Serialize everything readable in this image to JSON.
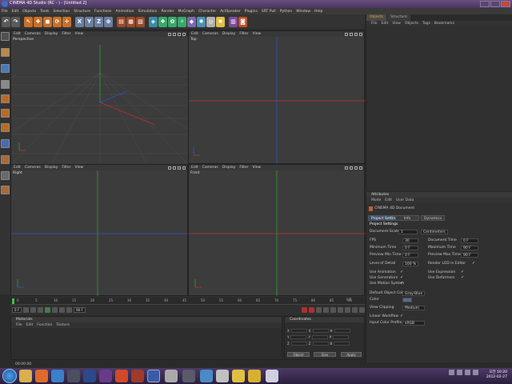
{
  "window": {
    "title": "CINEMA 4D Studio (RC - ) - [Untitled 2]"
  },
  "menubar": [
    "File",
    "Edit",
    "Objects",
    "Tools",
    "Selection",
    "Structure",
    "Functions",
    "Animation",
    "Simulation",
    "Render",
    "MoGraph",
    "Character",
    "ActSpeaker",
    "Plugins",
    "SRT Pull",
    "Python",
    "Window",
    "Help"
  ],
  "viewport_menu": [
    "Edit",
    "Cameras",
    "Display",
    "Filter",
    "View"
  ],
  "viewports": {
    "perspective": "Perspective",
    "top": "Top",
    "right": "Right",
    "front": "Front"
  },
  "timeline": {
    "ticks": [
      "0",
      "5",
      "10",
      "15",
      "20",
      "25",
      "30",
      "35",
      "40",
      "45",
      "50",
      "55",
      "60",
      "65",
      "70",
      "75",
      "80",
      "85",
      "90"
    ],
    "current_frame": "0 F",
    "start_field": "0 F",
    "end_field": "90 F",
    "end_label": "0 F"
  },
  "materials": {
    "title": "Materials",
    "menu": [
      "File",
      "Edit",
      "Function",
      "Texture"
    ]
  },
  "coordinates": {
    "title": "Coordinates",
    "rows": [
      "X",
      "Y",
      "Z"
    ],
    "size_labels": [
      "H",
      "P",
      "B"
    ],
    "buttons": {
      "object": "Object",
      "size": "Size",
      "apply": "Apply"
    }
  },
  "object_panel": {
    "tabs": [
      "Objects",
      "Structure"
    ],
    "menu": [
      "File",
      "Edit",
      "View",
      "Objects",
      "Tags",
      "Bookmarks"
    ]
  },
  "attributes": {
    "title": "Attributes",
    "menu": [
      "Mode",
      "Edit",
      "User Data"
    ],
    "doc_label": "CINEMA 4D Document",
    "tabs": [
      "Project Settings",
      "Info",
      "Dynamics"
    ],
    "section": "Project Settings",
    "document_scale_label": "Document Scale",
    "document_scale_value": "1",
    "document_scale_unit": "Centimeters",
    "fps_label": "FPS",
    "fps_value": "30",
    "doc_time_label": "Document Time",
    "doc_time_value": "0 F",
    "min_time_label": "Minimum Time",
    "min_time_value": "0 F",
    "max_time_label": "Maximum Time",
    "max_time_value": "90 F",
    "prev_min_label": "Preview Min Time",
    "prev_min_value": "0 F",
    "prev_max_label": "Preview Max Time",
    "prev_max_value": "90 F",
    "lod_label": "Level of Detail",
    "lod_value": "100 %",
    "render_lod_label": "Render LOD in Editor",
    "use_animation": "Use Animation",
    "use_expression": "Use Expression",
    "use_generators": "Use Generators",
    "use_deformers": "Use Deformers",
    "use_motion": "Use Motion System",
    "default_color_label": "Default Object Color",
    "default_color_value": "Gray-Blue",
    "color_label": "Color",
    "view_clipping_label": "View Clipping",
    "view_clipping_value": "Medium",
    "linear_workflow_label": "Linear Workflow",
    "input_color_label": "Input Color Profile",
    "input_color_value": "sRGB"
  },
  "statusbar": {
    "text": "00:00:00"
  },
  "taskbar": {
    "clock_time": "오전 10:20",
    "clock_date": "2012-02-27"
  },
  "colors": {
    "axis_x": "#c03030",
    "axis_y": "#30a030",
    "axis_z": "#3050d0",
    "accent_tab": "#e0a040"
  }
}
